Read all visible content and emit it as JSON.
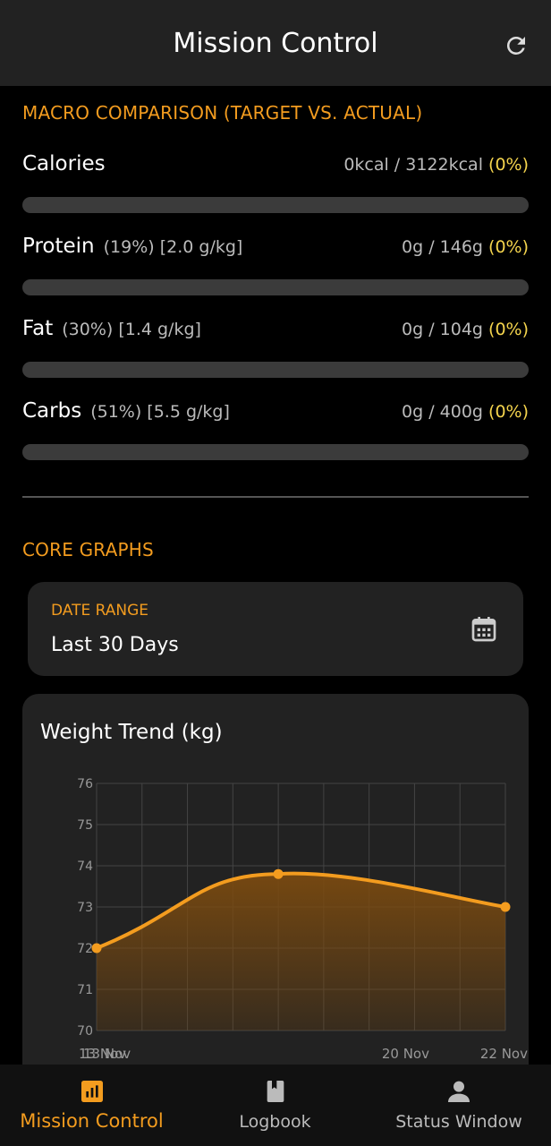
{
  "header": {
    "title": "Mission Control"
  },
  "macro_section": {
    "title": "MACRO COMPARISON (TARGET VS. ACTUAL)",
    "items": [
      {
        "name": "Calories",
        "sub": "",
        "value": "0kcal / 3122kcal",
        "pct": "(0%)",
        "progress": 0
      },
      {
        "name": "Protein",
        "sub": "(19%) [2.0 g/kg]",
        "value": "0g / 146g",
        "pct": "(0%)",
        "progress": 0
      },
      {
        "name": "Fat",
        "sub": "(30%) [1.4 g/kg]",
        "value": "0g / 104g",
        "pct": "(0%)",
        "progress": 0
      },
      {
        "name": "Carbs",
        "sub": "(51%) [5.5 g/kg]",
        "value": "0g / 400g",
        "pct": "(0%)",
        "progress": 0
      }
    ]
  },
  "graphs_section": {
    "title": "CORE GRAPHS",
    "date_range": {
      "label": "DATE RANGE",
      "value": "Last 30 Days"
    }
  },
  "chart_data": {
    "type": "area",
    "title": "Weight Trend (kg)",
    "x": [
      "13 Nov",
      "13 Nov",
      "20 Nov",
      "22 Nov"
    ],
    "x_tick_labels": [
      "13 Nov",
      "13 Nov",
      "20 Nov",
      "22 Nov"
    ],
    "points": [
      {
        "date": "13 Nov",
        "value": 72.0
      },
      {
        "date": "17 Nov",
        "value": 73.8
      },
      {
        "date": "22 Nov",
        "value": 73.0
      }
    ],
    "y_ticks": [
      70,
      71,
      72,
      73,
      74,
      75,
      76
    ],
    "ylim": [
      70,
      76
    ],
    "grid": true,
    "colors": {
      "line": "#f39c1f",
      "fill": "#7a4a10"
    }
  },
  "nav": {
    "items": [
      {
        "label": "Mission Control",
        "icon": "bar-chart-icon",
        "active": true
      },
      {
        "label": "Logbook",
        "icon": "book-icon",
        "active": false
      },
      {
        "label": "Status Window",
        "icon": "person-icon",
        "active": false
      }
    ]
  },
  "colors": {
    "accent": "#f39c1f",
    "percent": "#f4d44d",
    "card": "#222222",
    "track": "#3b3b3b"
  }
}
